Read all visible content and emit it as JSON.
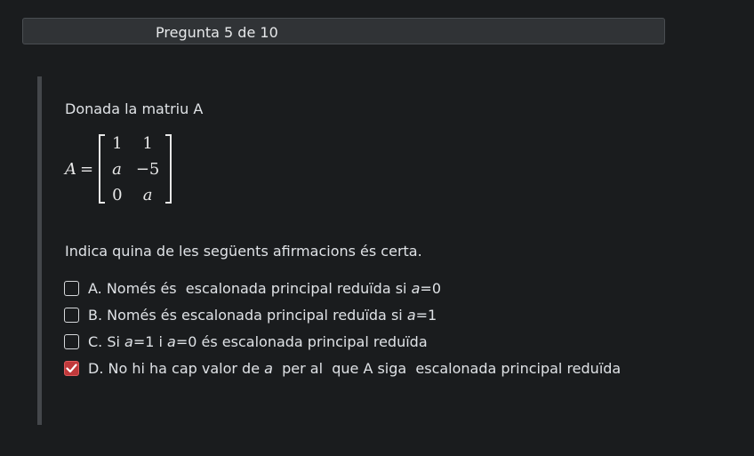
{
  "header": {
    "question_counter": "Pregunta 5 de 10"
  },
  "question": {
    "prompt": "Donada la matriu  A",
    "matrix": {
      "name": "A",
      "equals": "=",
      "rows": [
        [
          "1",
          "1"
        ],
        [
          "a",
          "−5"
        ],
        [
          "0",
          "a"
        ]
      ]
    },
    "instruction": "Indica quina de les següents afirmacions és certa."
  },
  "options": [
    {
      "id": "A",
      "text_before": "A. Només és  escalonada principal reduïda si ",
      "var": "a",
      "text_after": "=0",
      "checked": false
    },
    {
      "id": "B",
      "text_before": "B. Només és escalonada principal reduïda si ",
      "var": "a",
      "text_after": "=1",
      "checked": false
    },
    {
      "id": "C",
      "text_before": "C. Si ",
      "var": "a",
      "text_after": "=1 i ",
      "var2": "a",
      "text_after2": "=0 és escalonada principal reduïda",
      "checked": false
    },
    {
      "id": "D",
      "text_before": "D. No hi ha cap valor de ",
      "var": "a",
      "text_after": "  per al  que A siga  escalonada principal reduïda",
      "checked": true
    }
  ],
  "colors": {
    "background": "#1a1c1e",
    "checked_accent": "#c0393b"
  }
}
